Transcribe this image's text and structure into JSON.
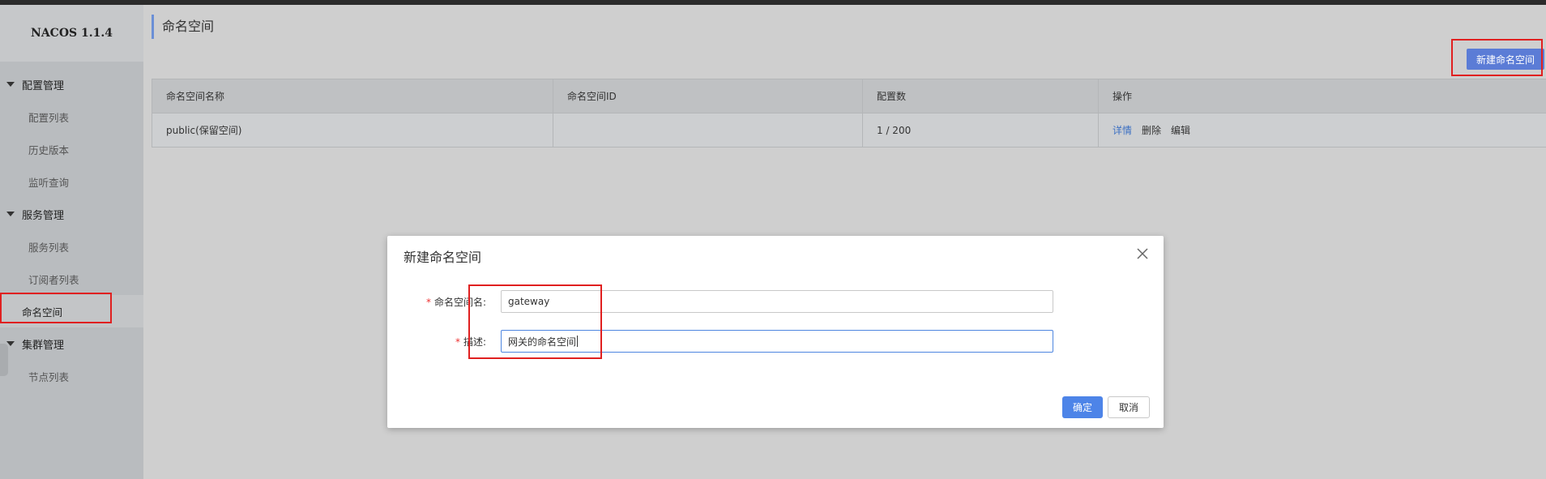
{
  "app": {
    "brand": "NACOS 1.1.4"
  },
  "sidebar": {
    "groups": [
      {
        "label": "配置管理",
        "items": [
          "配置列表",
          "历史版本",
          "监听查询"
        ]
      },
      {
        "label": "服务管理",
        "items": [
          "服务列表",
          "订阅者列表",
          "命名空间"
        ]
      },
      {
        "label": "集群管理",
        "items": [
          "节点列表"
        ]
      }
    ],
    "active_item": "命名空间"
  },
  "page": {
    "title": "命名空间",
    "new_button": "新建命名空间"
  },
  "table": {
    "headers": [
      "命名空间名称",
      "命名空间ID",
      "配置数",
      "操作"
    ],
    "rows": [
      {
        "name": "public(保留空间)",
        "id": "",
        "count": "1 / 200",
        "actions": [
          "详情",
          "删除",
          "编辑"
        ]
      }
    ]
  },
  "dialog": {
    "title": "新建命名空间",
    "fields": [
      {
        "label": "命名空间名:",
        "value": "gateway"
      },
      {
        "label": "描述:",
        "value": "网关的命名空间"
      }
    ],
    "ok_label": "确定",
    "cancel_label": "取消"
  },
  "colors": {
    "primary": "#4d84e8",
    "highlight": "#e02020",
    "link": "#3b6fc2"
  }
}
